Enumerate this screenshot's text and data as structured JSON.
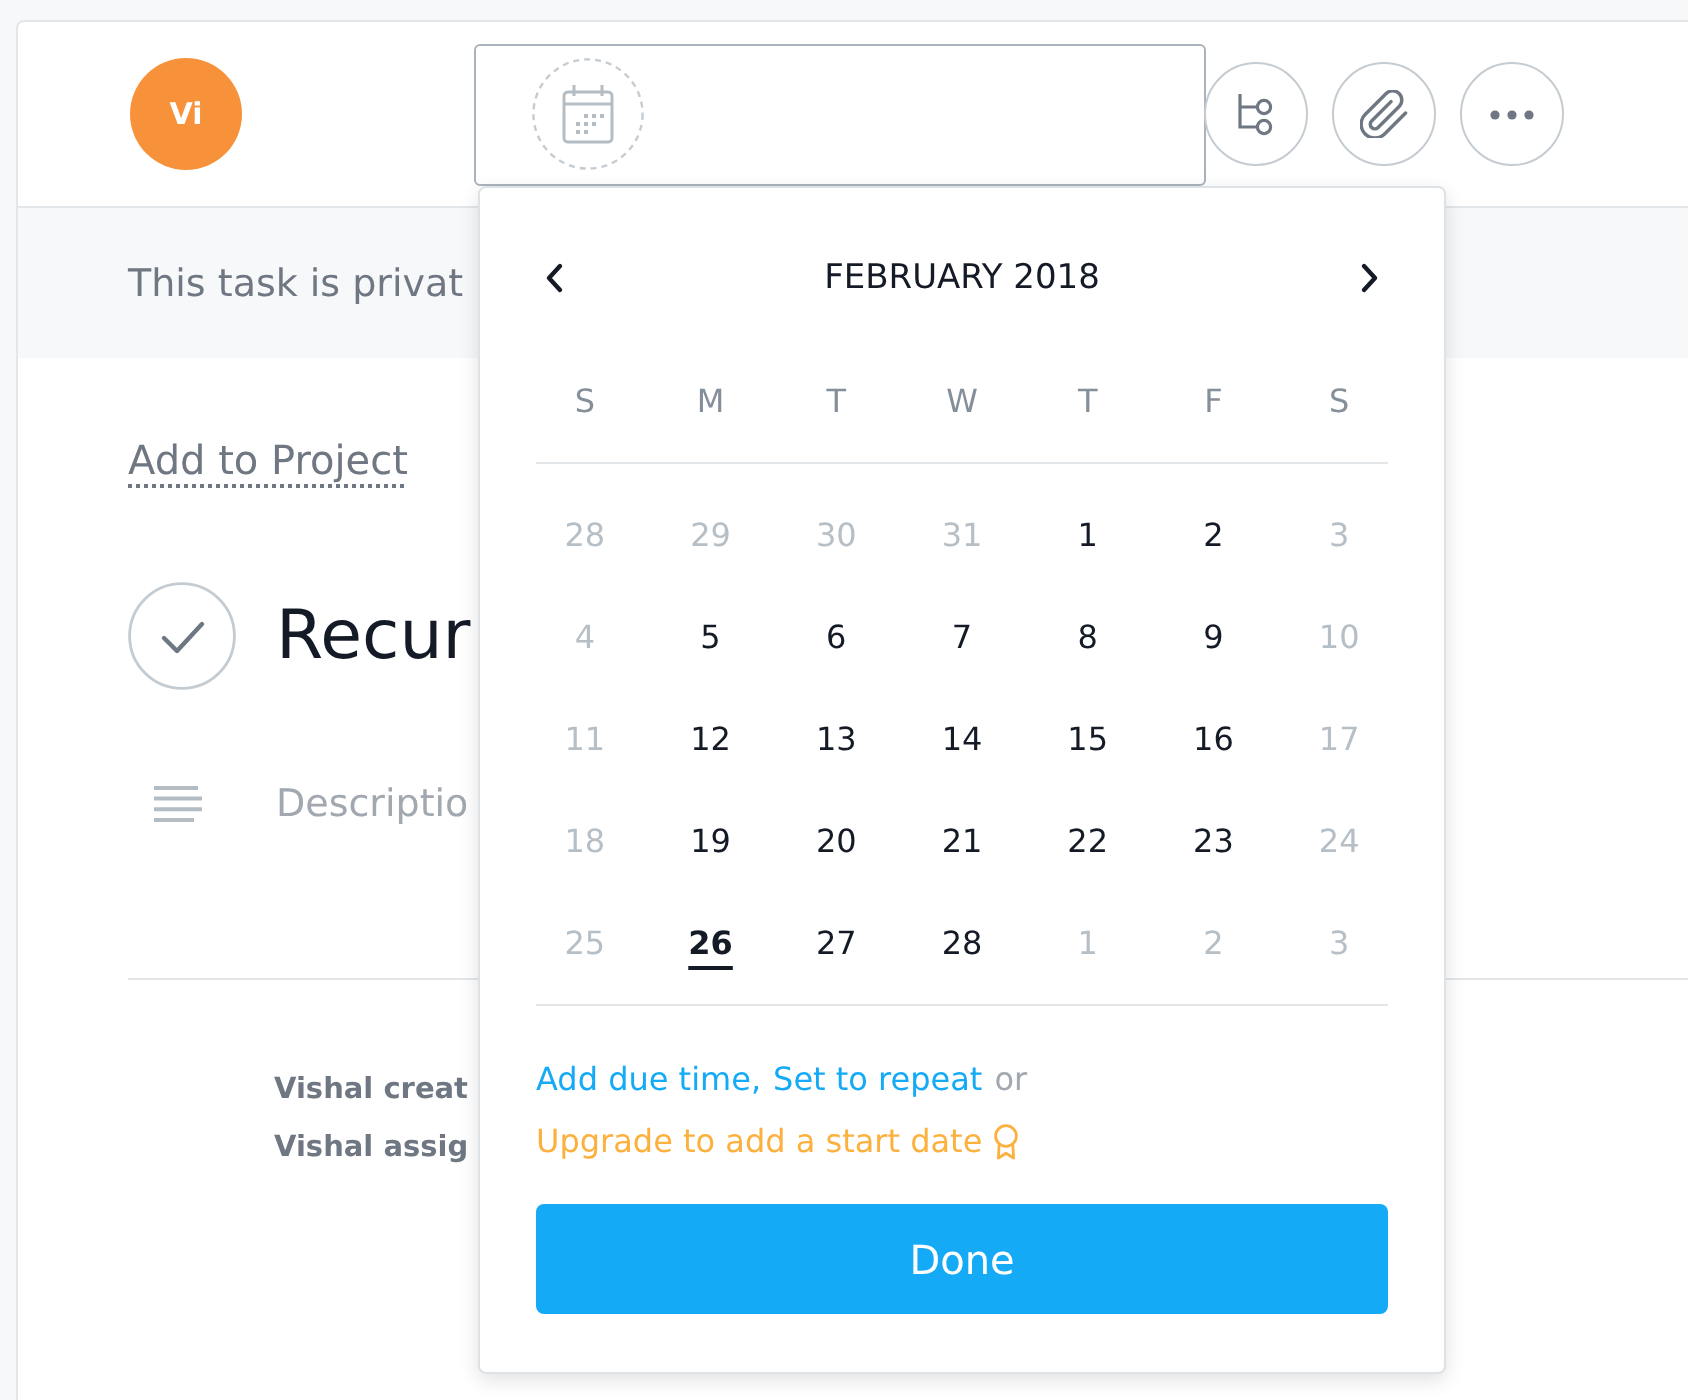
{
  "header": {
    "avatar_initials": "Vi",
    "toolbar": [
      {
        "kind": "subtasks"
      },
      {
        "kind": "attachment"
      },
      {
        "kind": "more"
      }
    ]
  },
  "privacy_notice": "This task is privat",
  "body": {
    "add_to_project": "Add to Project",
    "task": {
      "completed": false,
      "title": "Recur"
    },
    "description": {
      "placeholder": "Descriptio"
    },
    "activity": [
      "Vishal creat",
      "Vishal assig"
    ]
  },
  "date_picker": {
    "month_label": "FEBRUARY 2018",
    "weekdays": [
      "S",
      "M",
      "T",
      "W",
      "T",
      "F",
      "S"
    ],
    "weeks": [
      {
        "days": [
          {
            "day": "28",
            "dimmed": true,
            "today": false
          },
          {
            "day": "29",
            "dimmed": true,
            "today": false
          },
          {
            "day": "30",
            "dimmed": true,
            "today": false
          },
          {
            "day": "31",
            "dimmed": true,
            "today": false
          },
          {
            "day": "1",
            "dimmed": false,
            "today": false
          },
          {
            "day": "2",
            "dimmed": false,
            "today": false
          },
          {
            "day": "3",
            "dimmed": true,
            "today": false
          }
        ]
      },
      {
        "days": [
          {
            "day": "4",
            "dimmed": true,
            "today": false
          },
          {
            "day": "5",
            "dimmed": false,
            "today": false
          },
          {
            "day": "6",
            "dimmed": false,
            "today": false
          },
          {
            "day": "7",
            "dimmed": false,
            "today": false
          },
          {
            "day": "8",
            "dimmed": false,
            "today": false
          },
          {
            "day": "9",
            "dimmed": false,
            "today": false
          },
          {
            "day": "10",
            "dimmed": true,
            "today": false
          }
        ]
      },
      {
        "days": [
          {
            "day": "11",
            "dimmed": true,
            "today": false
          },
          {
            "day": "12",
            "dimmed": false,
            "today": false
          },
          {
            "day": "13",
            "dimmed": false,
            "today": false
          },
          {
            "day": "14",
            "dimmed": false,
            "today": false
          },
          {
            "day": "15",
            "dimmed": false,
            "today": false
          },
          {
            "day": "16",
            "dimmed": false,
            "today": false
          },
          {
            "day": "17",
            "dimmed": true,
            "today": false
          }
        ]
      },
      {
        "days": [
          {
            "day": "18",
            "dimmed": true,
            "today": false
          },
          {
            "day": "19",
            "dimmed": false,
            "today": false
          },
          {
            "day": "20",
            "dimmed": false,
            "today": false
          },
          {
            "day": "21",
            "dimmed": false,
            "today": false
          },
          {
            "day": "22",
            "dimmed": false,
            "today": false
          },
          {
            "day": "23",
            "dimmed": false,
            "today": false
          },
          {
            "day": "24",
            "dimmed": true,
            "today": false
          }
        ]
      },
      {
        "days": [
          {
            "day": "25",
            "dimmed": true,
            "today": false
          },
          {
            "day": "26",
            "dimmed": false,
            "today": true
          },
          {
            "day": "27",
            "dimmed": false,
            "today": false
          },
          {
            "day": "28",
            "dimmed": false,
            "today": false
          },
          {
            "day": "1",
            "dimmed": true,
            "today": false
          },
          {
            "day": "2",
            "dimmed": true,
            "today": false
          },
          {
            "day": "3",
            "dimmed": true,
            "today": false
          }
        ]
      }
    ],
    "options": [
      {
        "kind": "link",
        "text": "Add due time,"
      },
      {
        "kind": "link",
        "text": "Set to repeat"
      },
      {
        "kind": "text",
        "text": "or"
      }
    ],
    "upgrade_link": "Upgrade to add a start date",
    "done_button": "Done"
  }
}
